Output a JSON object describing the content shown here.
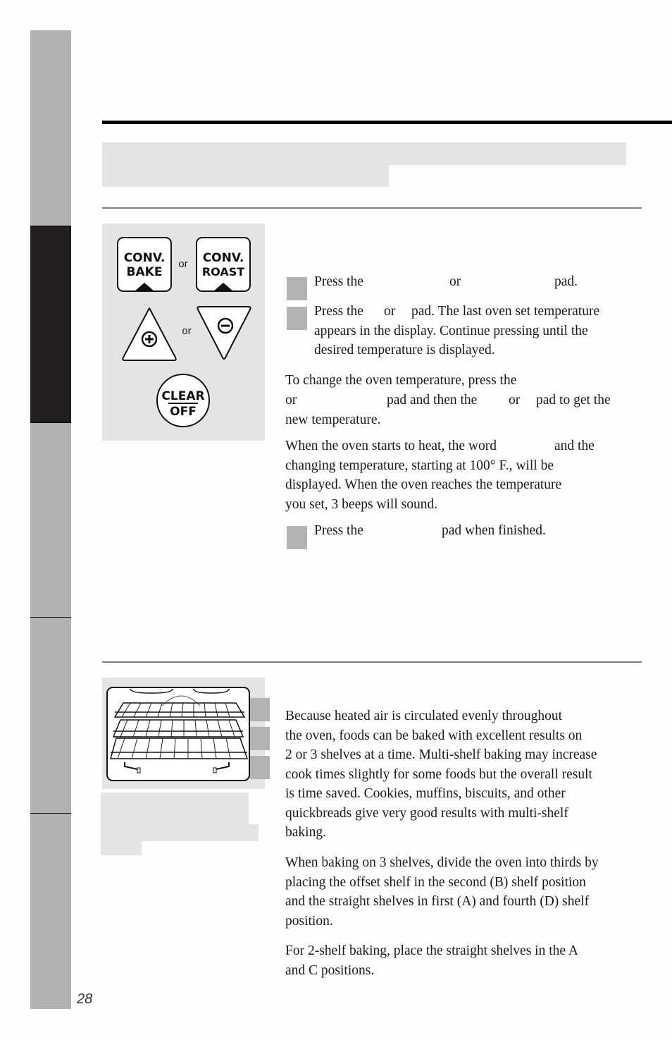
{
  "page": {
    "page_number": "28"
  },
  "side_tabs": [
    {
      "name": "tab-1",
      "active": false
    },
    {
      "name": "tab-2",
      "active": true
    },
    {
      "name": "tab-3",
      "active": false
    },
    {
      "name": "tab-4",
      "active": false
    },
    {
      "name": "tab-5",
      "active": false
    }
  ],
  "control_pads": {
    "conv_bake": {
      "line1": "CONV.",
      "line2": "BAKE"
    },
    "conv_roast": {
      "line1": "CONV.",
      "line2": "ROAST"
    },
    "or_1": "or",
    "or_2": "or",
    "clear_off": {
      "line1": "CLEAR",
      "line2": "OFF"
    }
  },
  "section1": {
    "step1": {
      "a": "Press the",
      "b": "or",
      "c": "pad."
    },
    "step2": {
      "line1_a": "Press the",
      "line1_b": "or",
      "line1_c": "pad. The last oven set temperature",
      "line2": "appears in the display. Continue pressing until the",
      "line3": "desired temperature is displayed."
    },
    "para_change": {
      "line1": "To change the oven temperature, press the",
      "line2_a": "or",
      "line2_b": "pad and then the",
      "line2_c": "or",
      "line2_d": "pad to get the",
      "line3": "new temperature."
    },
    "para_heat": {
      "line1_a": "When the oven starts to heat, the word",
      "line1_b": "and the",
      "line2": "changing temperature, starting at 100° F., will be",
      "line3": "displayed. When the oven reaches the temperature",
      "line4": "you set, 3 beeps will sound."
    },
    "step3": {
      "a": "Press the",
      "b": "pad when finished."
    }
  },
  "section2": {
    "para1": [
      "Because heated air is circulated evenly throughout",
      "the oven, foods can be baked with excellent results on",
      "2 or 3 shelves at a time. Multi-shelf baking may increase",
      "cook times slightly for some foods but the overall result",
      "is time saved. Cookies, muffins, biscuits, and other",
      "quickbreads give very good results with multi-shelf",
      "baking."
    ],
    "para2": [
      "When baking on 3 shelves, divide the oven into thirds by",
      "placing the offset shelf in the second (B) shelf position",
      "and the straight shelves in first (A) and fourth (D) shelf",
      "position."
    ],
    "para3": [
      "For 2-shelf baking, place the straight shelves in the A",
      "and C positions."
    ]
  }
}
